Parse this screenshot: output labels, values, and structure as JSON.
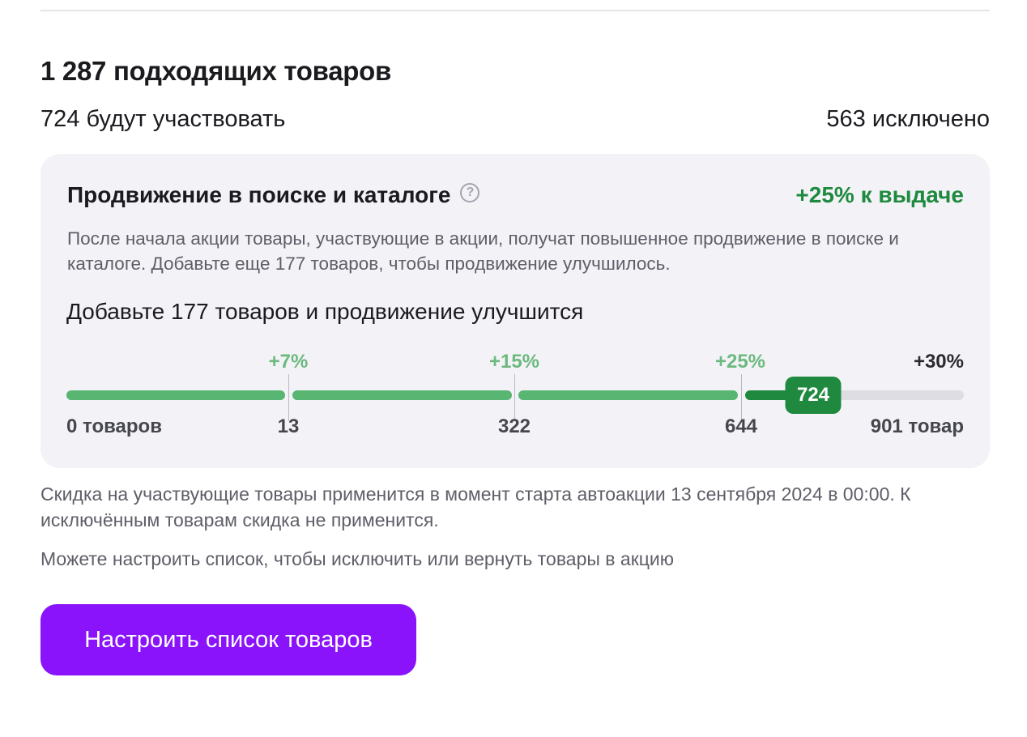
{
  "summary": {
    "heading": "1 287 подходящих товаров",
    "participating": "724 будут участвовать",
    "excluded": "563 исключено"
  },
  "promo": {
    "title": "Продвижение в поиске и каталоге",
    "help_icon": "question-circle-icon",
    "boost": "+25% к выдаче",
    "description": "После начала акции товары, участвующие в акции, получат повышенное продвижение в поиске и каталоге. Добавьте еще 177 товаров, чтобы продвижение улучшилось.",
    "subtitle": "Добавьте 177 товаров и продвижение улучшится",
    "progress": {
      "current_value": "724",
      "current_count": 724,
      "thresholds": [
        {
          "count": 0,
          "label": "0 товаров",
          "percent": ""
        },
        {
          "count": 13,
          "label": "13",
          "percent": "+7%"
        },
        {
          "count": 322,
          "label": "322",
          "percent": "+15%"
        },
        {
          "count": 644,
          "label": "644",
          "percent": "+25%"
        },
        {
          "count": 901,
          "label": "901 товар",
          "percent": "+30%"
        }
      ],
      "colors": {
        "reached": "#58b572",
        "current": "#1f8a3f",
        "remaining": "#dddde3",
        "reached_percent": "#6cb97e"
      }
    }
  },
  "note": "Скидка на участвующие товары применится в момент старта автоакции 13 сентября 2024 в 00:00. К исключённым товарам скидка не применится.",
  "hint": "Можете настроить список, чтобы исключить или вернуть товары в акцию",
  "action": {
    "button_label": "Настроить список товаров",
    "color": "#8a13fb"
  }
}
